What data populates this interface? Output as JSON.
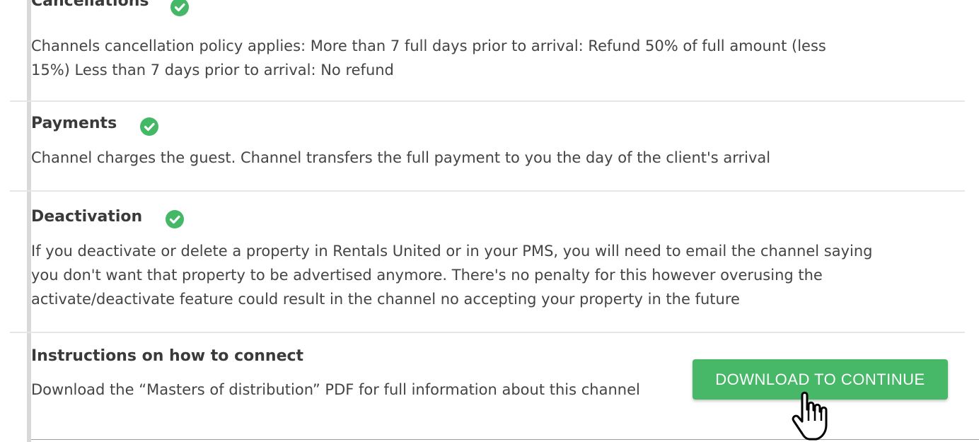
{
  "sections": {
    "cancellations": {
      "title": "Cancellations",
      "lines": [
        "Channels cancellation policy applies: More than 7 full days prior to arrival: Refund 50% of full amount (less",
        "15%) Less than 7 days prior to arrival: No refund"
      ]
    },
    "payments": {
      "title": "Payments",
      "lines": [
        "Channel charges the guest. Channel transfers the full payment to you the day of the client's arrival"
      ]
    },
    "deactivation": {
      "title": "Deactivation",
      "lines": [
        "If you deactivate or delete a property in Rentals United or in your PMS, you will need to email the channel saying",
        "you don't want that property to be advertised anymore. There's no penalty for this however overusing the",
        "activate/deactivate feature could result in the channel no accepting your property in the future"
      ]
    },
    "instructions": {
      "title": "Instructions on how to connect",
      "lines": [
        "Download the “Masters of distribution” PDF for full information about this channel"
      ],
      "button_label": "DOWNLOAD TO CONTINUE"
    }
  },
  "icons": {
    "status": "check-circle-icon",
    "pointer": "hand-pointer-icon"
  },
  "colors": {
    "accent_green": "#44b866",
    "button_green": "#47b768",
    "text": "#444444"
  }
}
